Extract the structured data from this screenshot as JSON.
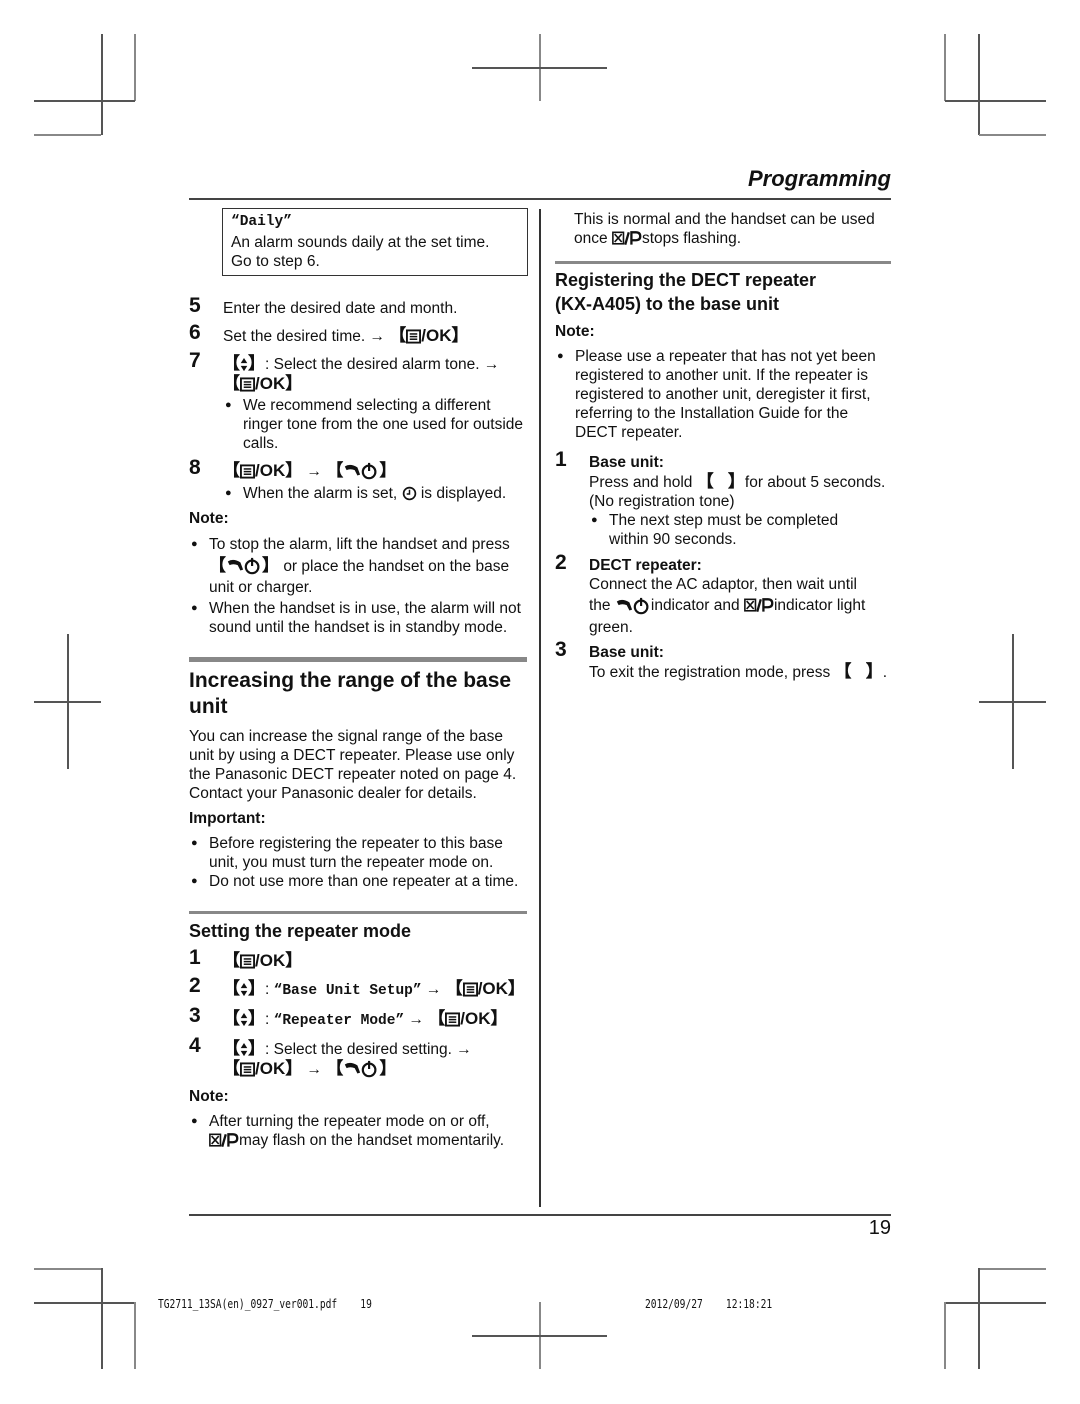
{
  "header": {
    "section_title": "Programming"
  },
  "left": {
    "daily_box": {
      "option": "“Daily”",
      "line1": "An alarm sounds daily at the set time.",
      "line2": "Go to step 6."
    },
    "steps": [
      {
        "num": "5",
        "text": "Enter the desired date and month."
      },
      {
        "num": "6",
        "text": "Set the desired time.",
        "arrow": "→",
        "key": "/OK"
      },
      {
        "num": "7",
        "text": ": Select the desired alarm tone.",
        "arrow": "→",
        "key": "/OK",
        "bullets": [
          "We recommend selecting a different ringer tone from the one used for outside calls."
        ]
      },
      {
        "num": "8",
        "key": "/OK",
        "arrow": "→",
        "bullets_pre": "When the alarm is set,",
        "bullets_post": "is displayed."
      }
    ],
    "note1": {
      "title": "Note:",
      "b1_pre": "To stop the alarm, lift the handset and press",
      "b1_post": "or place the handset on the base unit or charger.",
      "b2": "When the handset is in use, the alarm will not sound until the handset is in standby mode."
    },
    "range_section": {
      "title": "Increasing the range of the base unit",
      "body": "You can increase the signal range of the base unit by using a DECT repeater. Please use only the Panasonic DECT repeater noted on page 4. Contact your Panasonic dealer for details.",
      "important_title": "Important:",
      "bullets": [
        "Before registering the repeater to this base unit, you must turn the repeater mode on.",
        "Do not use more than one repeater at a time."
      ]
    },
    "repeater_mode": {
      "title": "Setting the repeater mode",
      "steps": [
        {
          "num": "1",
          "key": "/OK"
        },
        {
          "num": "2",
          "menu": "“Base Unit Setup”",
          "arrow": "→",
          "key": "/OK"
        },
        {
          "num": "3",
          "menu": "“Repeater Mode”",
          "arrow": "→",
          "key": "/OK"
        },
        {
          "num": "4",
          "text": ": Select the desired setting.",
          "arrow": "→",
          "key": "/OK"
        }
      ],
      "note_title": "Note:",
      "note_post": "may flash on the handset momentarily.",
      "note_pre": "After turning the repeater mode on or off,"
    }
  },
  "right": {
    "continued": {
      "line1": "This is normal and the handset can be used",
      "pre": "once",
      "post": "stops flashing."
    },
    "register_section": {
      "title_line1": "Registering the DECT repeater",
      "title_line2": "(KX-A405) to the base unit",
      "note_title": "Note:",
      "note_bullet": "Please use a repeater that has not yet been registered to another unit. If the repeater is registered to another unit, deregister it first, referring to the Installation Guide for the DECT repeater.",
      "steps": [
        {
          "num": "1",
          "label": "Base unit:",
          "text_pre": "Press and hold",
          "text_post": "for about 5 seconds.",
          "text2": "(No registration tone)",
          "bullet": "The next step must be completed within 90 seconds."
        },
        {
          "num": "2",
          "label": "DECT repeater:",
          "line1": "Connect the AC adaptor, then wait until",
          "pre": "the",
          "mid": "indicator and",
          "post": "indicator light",
          "line3": "green."
        },
        {
          "num": "3",
          "label": "Base unit:",
          "text": "To exit the registration mode, press"
        }
      ]
    }
  },
  "footer": {
    "page_number": "19",
    "file_info": "TG2711_13SA(en)_0927_ver001.pdf    19",
    "timestamp": "2012/09/27    12:18:21"
  }
}
